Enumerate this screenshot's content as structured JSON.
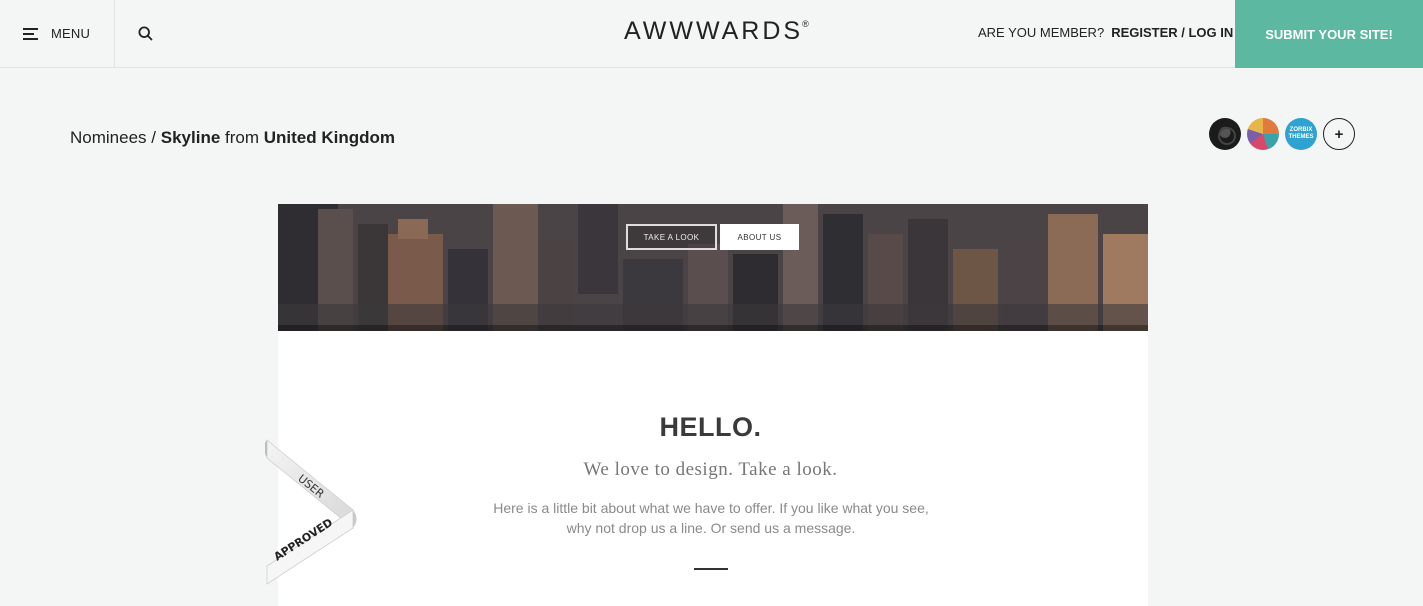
{
  "header": {
    "menu_label": "MENU",
    "logo": "AWWWARDS",
    "logo_mark": "®",
    "member_question": "ARE YOU MEMBER?",
    "member_link": "REGISTER / LOG IN",
    "submit_label": "SUBMIT YOUR SITE!"
  },
  "breadcrumb": {
    "section": "Nominees",
    "separator": "/",
    "site_name": "Skyline",
    "from": "from",
    "country": "United Kingdom"
  },
  "avatars": {
    "third_line1": "ZORBIX",
    "third_line2": "THEMES",
    "more_label": "+"
  },
  "preview": {
    "hero_btn_1": "TAKE A LOOK",
    "hero_btn_2": "ABOUT US",
    "hello": "HELLO.",
    "tagline": "We love to design. Take a look.",
    "para_line1": "Here is a little bit about what we have to offer. If you like what you see,",
    "para_line2": "why not drop us a line. Or send us a message."
  },
  "ribbon": {
    "line1": "USER",
    "line2": "APPROVED"
  },
  "colors": {
    "accent": "#5cb8a0",
    "background": "#f4f6f5"
  }
}
